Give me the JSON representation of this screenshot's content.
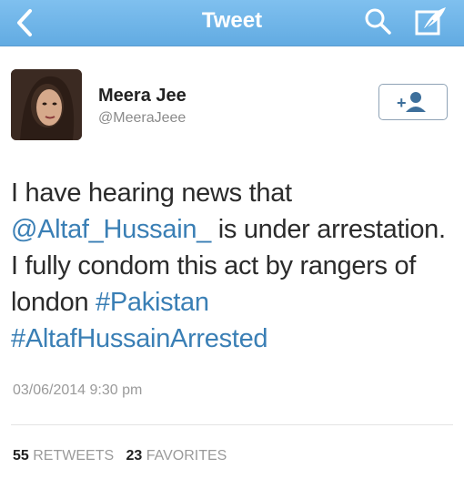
{
  "nav": {
    "title": "Tweet",
    "back_icon": "chevron-left-icon",
    "search_icon": "search-icon",
    "compose_icon": "compose-icon",
    "bar_color": "#6ab2e7"
  },
  "user": {
    "name": "Meera Jee",
    "handle": "@MeeraJeee",
    "follow_icon": "add-user-icon"
  },
  "tweet": {
    "text_part1": "I have hearing news that ",
    "mention": "@Altaf_Hussain_",
    "text_part2": " is under arrestation. I fully condom this act by rangers of london ",
    "hashtag1": "#Pakistan",
    "hashtag2": "#AltafHussainArrested",
    "timestamp": "03/06/2014 9:30 pm",
    "link_color": "#3a7fb5"
  },
  "stats": {
    "retweets_count": "55",
    "retweets_label": "RETWEETS",
    "favorites_count": "23",
    "favorites_label": "FAVORITES"
  }
}
